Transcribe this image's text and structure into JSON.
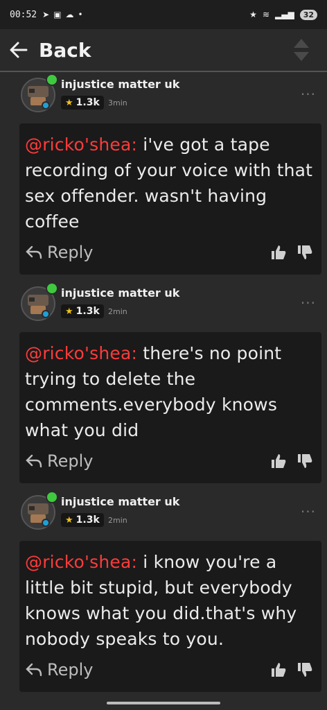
{
  "status_bar": {
    "time": "00:52",
    "battery": "32"
  },
  "nav": {
    "back_label": "Back"
  },
  "comments": [
    {
      "username": "injustice matter uk",
      "rep": "1.3k",
      "time": "3min",
      "mention": "@ricko'shea:",
      "text": " i've got a tape recording of your voice with that sex offender. wasn't having coffee",
      "reply_label": "Reply"
    },
    {
      "username": "injustice matter uk",
      "rep": "1.3k",
      "time": "2min",
      "mention": "@ricko'shea:",
      "text": " there's no point trying to delete the comments.everybody knows what you did",
      "reply_label": "Reply"
    },
    {
      "username": "injustice matter uk",
      "rep": "1.3k",
      "time": "2min",
      "mention": "@ricko'shea:",
      "text": " i know you're a little bit stupid, but everybody knows what you did.that's why nobody speaks to you.",
      "reply_label": "Reply"
    }
  ],
  "colors": {
    "mention": "#ff3b3b",
    "online": "#3fc93f",
    "star": "#f2c21b"
  },
  "icons": [
    "back-arrow-icon",
    "sort-icon",
    "more-icon",
    "reply-icon",
    "thumbs-up-icon",
    "thumbs-down-icon",
    "star-icon"
  ]
}
